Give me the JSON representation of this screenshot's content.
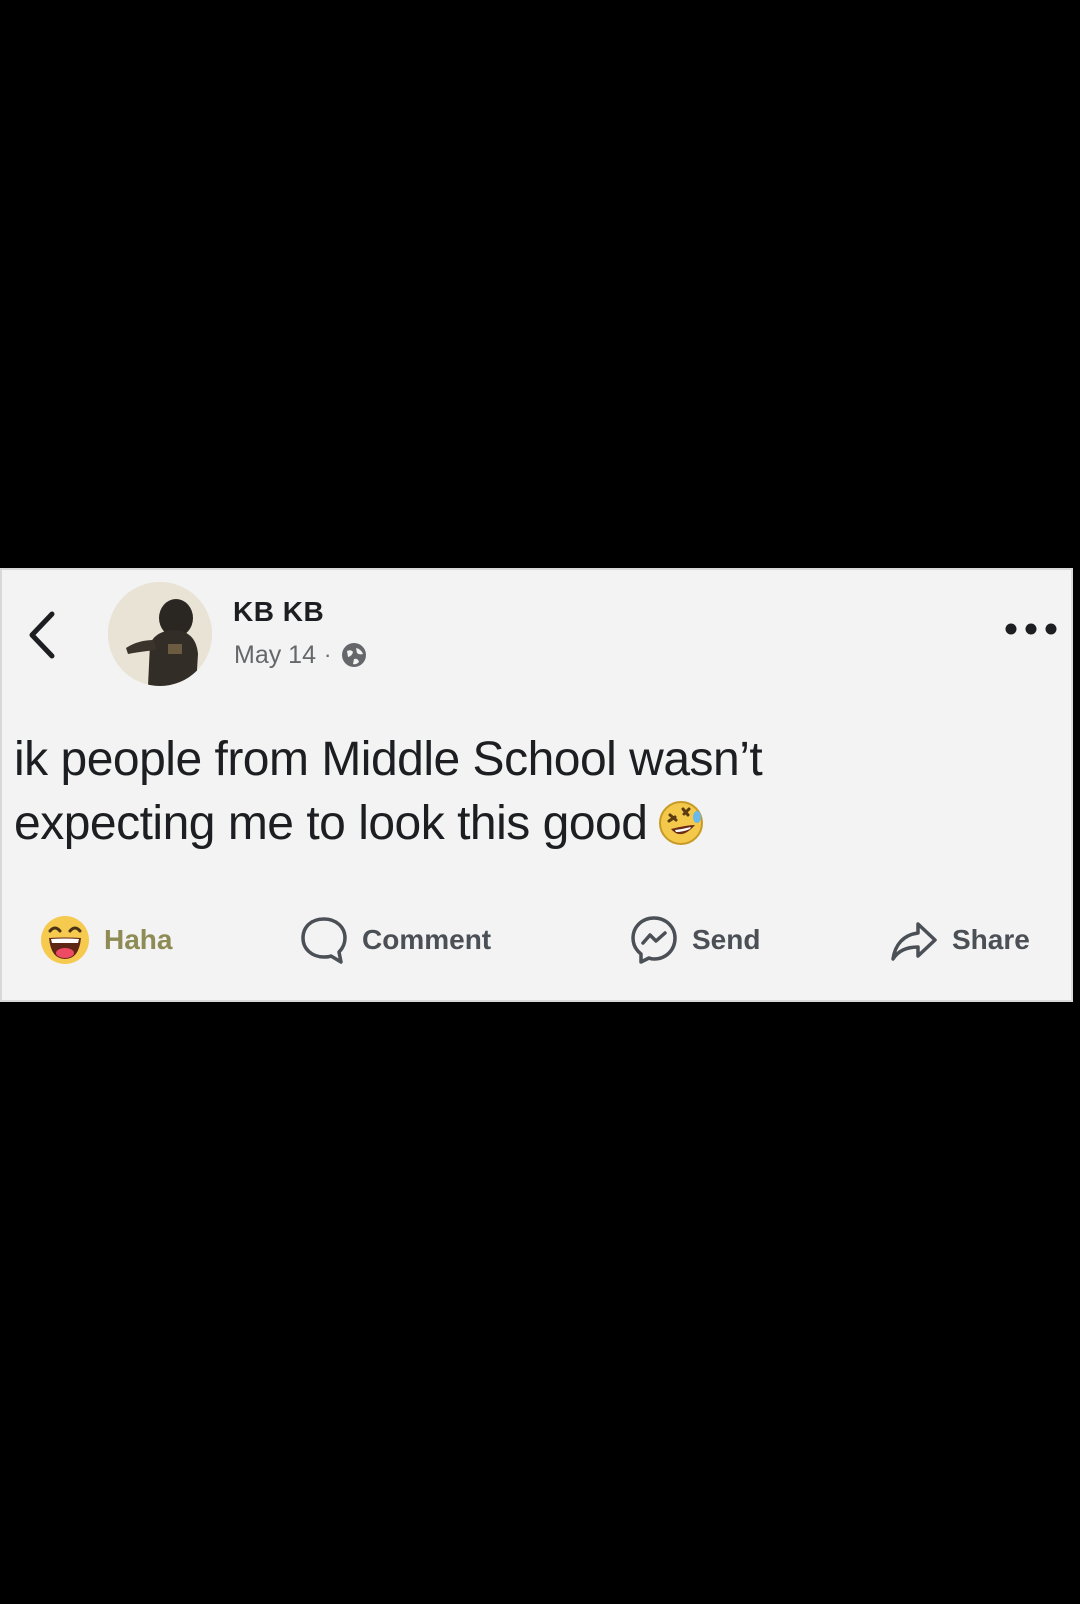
{
  "post": {
    "author": "KB KB",
    "date": "May 14",
    "separator": "·",
    "text_line_1": "ik people from Middle School wasn’t",
    "text_line_2": "expecting me to look this good"
  },
  "actions": {
    "haha_label": "Haha",
    "comment_label": "Comment",
    "send_label": "Send",
    "share_label": "Share"
  },
  "icons": {
    "back": "chevron-left-icon",
    "globe": "globe-icon",
    "more": "more-options-icon",
    "reaction": "haha-emoji-icon",
    "inline_emoji": "rolling-laughing-emoji-icon",
    "comment": "comment-bubble-icon",
    "send": "messenger-icon",
    "share": "share-arrow-icon"
  },
  "colors": {
    "card_background": "#f2f3f2",
    "page_background": "#000000",
    "reaction_label": "#8e8b55"
  }
}
